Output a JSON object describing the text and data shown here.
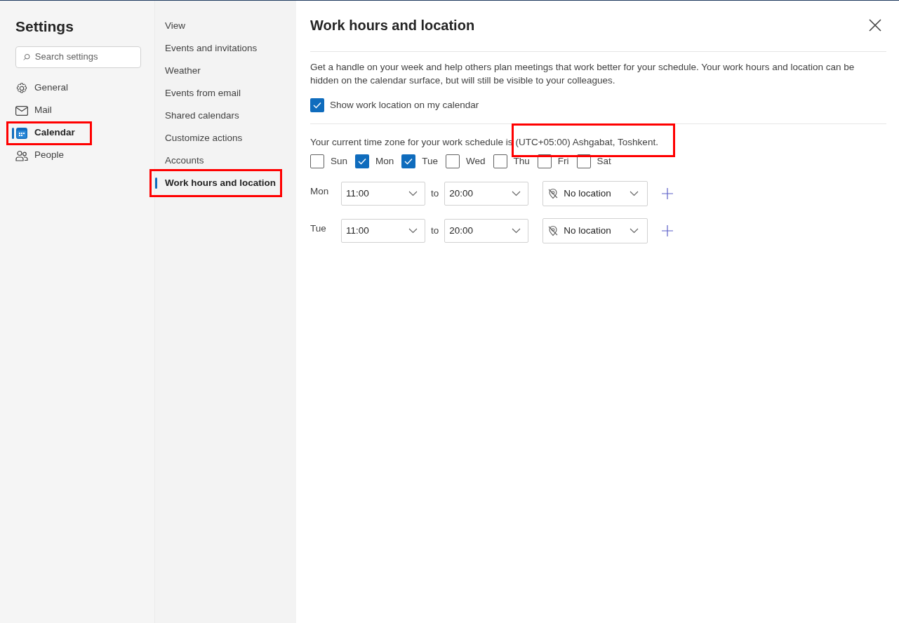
{
  "sidebar": {
    "title": "Settings",
    "search": {
      "placeholder": "Search settings"
    },
    "items": [
      {
        "label": "General",
        "selected": false,
        "highlighted": false
      },
      {
        "label": "Mail",
        "selected": false,
        "highlighted": false
      },
      {
        "label": "Calendar",
        "selected": true,
        "highlighted": true
      },
      {
        "label": "People",
        "selected": false,
        "highlighted": false
      }
    ]
  },
  "subnav": {
    "items": [
      {
        "label": "View",
        "selected": false,
        "highlighted": false
      },
      {
        "label": "Events and invitations",
        "selected": false,
        "highlighted": false
      },
      {
        "label": "Weather",
        "selected": false,
        "highlighted": false
      },
      {
        "label": "Events from email",
        "selected": false,
        "highlighted": false
      },
      {
        "label": "Shared calendars",
        "selected": false,
        "highlighted": false
      },
      {
        "label": "Customize actions",
        "selected": false,
        "highlighted": false
      },
      {
        "label": "Accounts",
        "selected": false,
        "highlighted": false
      },
      {
        "label": "Work hours and location",
        "selected": true,
        "highlighted": true
      }
    ]
  },
  "panel": {
    "title": "Work hours and location",
    "description": "Get a handle on your week and help others plan meetings that work better for your schedule. Your work hours and location can be hidden on the calendar surface, but will still be visible to your colleagues.",
    "show_location": {
      "label": "Show work location on my calendar",
      "checked": true
    },
    "timezone_label": "Your current time zone for your work schedule is",
    "timezone": "(UTC+05:00) Ashgabat, Toshkent.",
    "timezone_highlighted": true,
    "days": [
      {
        "label": "Sun",
        "checked": false
      },
      {
        "label": "Mon",
        "checked": true
      },
      {
        "label": "Tue",
        "checked": true
      },
      {
        "label": "Wed",
        "checked": false
      },
      {
        "label": "Thu",
        "checked": false
      },
      {
        "label": "Fri",
        "checked": false
      },
      {
        "label": "Sat",
        "checked": false
      }
    ],
    "schedule": [
      {
        "day": "Mon",
        "start": "11:00",
        "to": "to",
        "end": "20:00",
        "location": "No location"
      },
      {
        "day": "Tue",
        "start": "11:00",
        "to": "to",
        "end": "20:00",
        "location": "No location"
      }
    ]
  }
}
